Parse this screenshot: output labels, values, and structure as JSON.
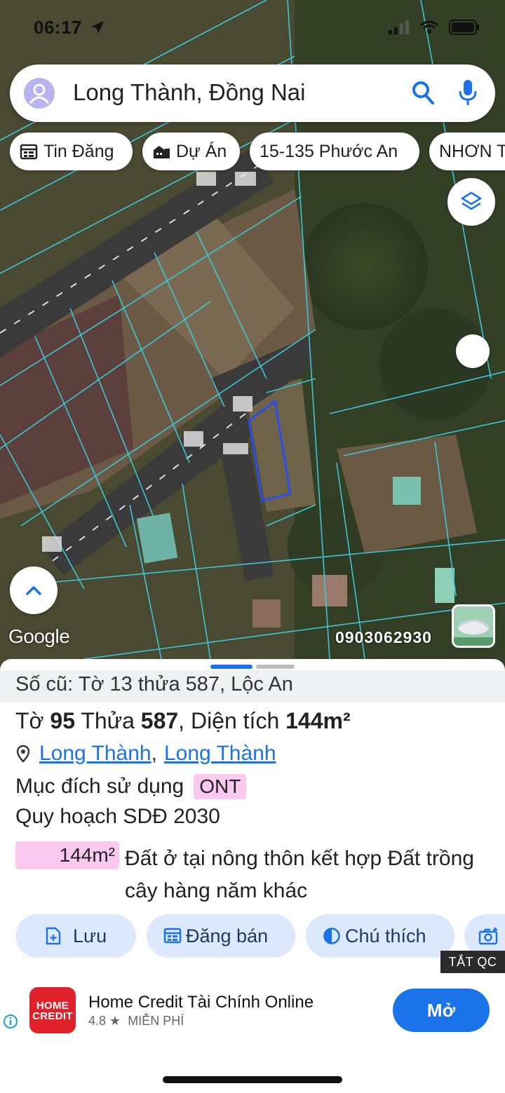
{
  "status": {
    "time": "06:17"
  },
  "search": {
    "query": "Long Thành, Đồng Nai"
  },
  "chips": [
    {
      "label": "Tin Đăng",
      "icon": "calendar-icon"
    },
    {
      "label": "Dự Án",
      "icon": "buildings-icon"
    },
    {
      "label": "15-135 Phước An"
    },
    {
      "label": "NHƠN T"
    }
  ],
  "map": {
    "attribution": "Google",
    "phone": "0903062930"
  },
  "parcel": {
    "old_info": "Số cũ: Tờ 13 thửa 587, Lộc An",
    "title_prefix": "Tờ",
    "sheet_no": "95",
    "parcel_label": "Thửa",
    "parcel_no": "587",
    "area_label": ", Diện tích",
    "area": "144m²",
    "district": "Long Thành",
    "ward": "Long Thành",
    "purpose_label": "Mục đích sử dụng",
    "purpose_code": "ONT",
    "plan_label": "Quy hoạch SDĐ 2030",
    "plan_area": "144m²",
    "plan_desc": "Đất ở tại nông thôn kết hợp Đất trồng cây hàng năm khác"
  },
  "actions": [
    {
      "label": "Lưu",
      "icon": "save-icon"
    },
    {
      "label": "Đăng bán",
      "icon": "calendar-icon"
    },
    {
      "label": "Chú thích",
      "icon": "contrast-icon"
    }
  ],
  "ad": {
    "close_label": "TẮT QC",
    "logo_text_1": "HOME",
    "logo_text_2": "CREDIT",
    "title": "Home Credit Tài Chính Online",
    "rating": "4.8 ★",
    "price": "MIỄN PHÍ",
    "button": "Mở"
  },
  "colors": {
    "accent": "#1a73e8",
    "highlight": "#fbc9f0",
    "parcel_line": "#3ec6d8"
  }
}
